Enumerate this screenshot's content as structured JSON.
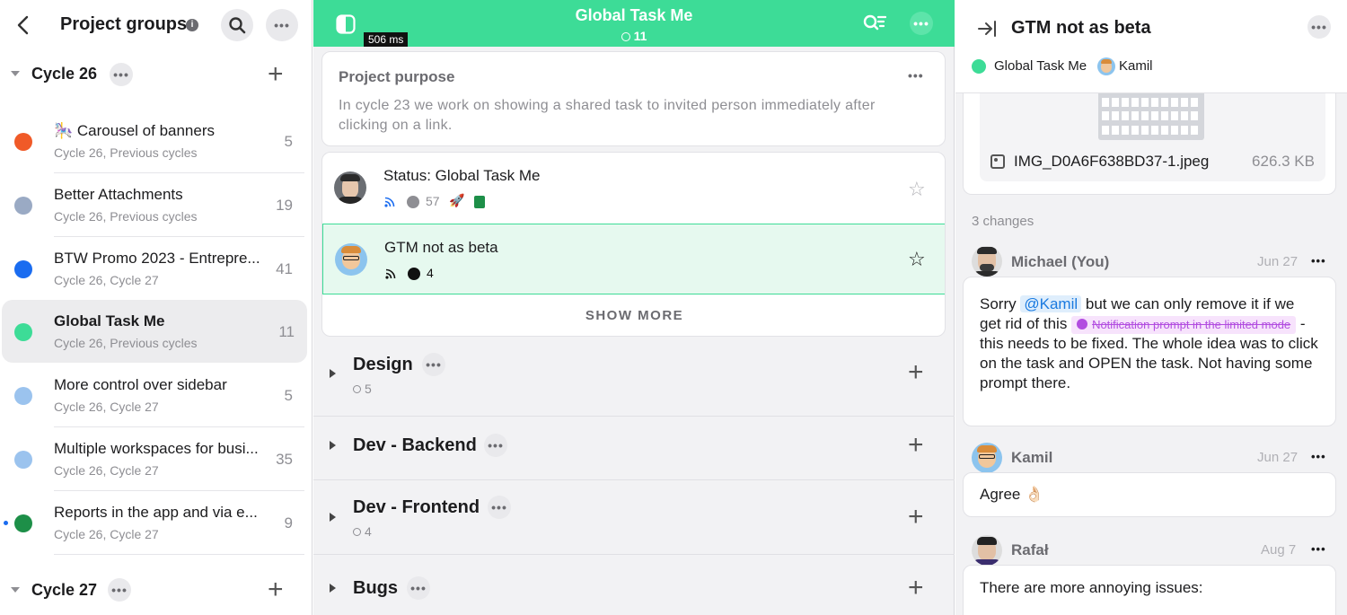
{
  "left": {
    "title": "Project groups",
    "cycles": [
      {
        "label": "Cycle 26"
      },
      {
        "label": "Cycle 27"
      }
    ],
    "items": [
      {
        "emoji": "🎠",
        "title": "Carousel of banners",
        "sub": "Cycle 26, Previous cycles",
        "count": "5",
        "color": "#f05a28"
      },
      {
        "title": "Better Attachments",
        "sub": "Cycle 26, Previous cycles",
        "count": "19",
        "color": "#9aaac4"
      },
      {
        "title": "BTW Promo 2023 - Entrepre...",
        "sub": "Cycle 26, Cycle 27",
        "count": "41",
        "color": "#1a6cf0"
      },
      {
        "title": "Global Task Me",
        "sub": "Cycle 26, Previous cycles",
        "count": "11",
        "color": "#3ddc97"
      },
      {
        "title": "More control over sidebar",
        "sub": "Cycle 26, Cycle 27",
        "count": "5",
        "color": "#9bc3ee"
      },
      {
        "title": "Multiple workspaces for busi...",
        "sub": "Cycle 26, Cycle 27",
        "count": "35",
        "color": "#9bc3ee"
      },
      {
        "title": "Reports in the app and via e...",
        "sub": "Cycle 26, Cycle 27",
        "count": "9",
        "color": "#1d8f48"
      }
    ]
  },
  "middle": {
    "title": "Global Task Me",
    "count": "11",
    "timing": "506 ms",
    "purpose": {
      "heading": "Project purpose",
      "text": "In cycle 23 we work on showing a shared task to invited person immediately after clicking on a link."
    },
    "tasks": [
      {
        "title": "Status: Global Task Me",
        "comments": "57"
      },
      {
        "title": "GTM not as beta",
        "comments": "4"
      }
    ],
    "show_more": "SHOW MORE",
    "groups": [
      {
        "title": "Design",
        "count": "5"
      },
      {
        "title": "Dev - Backend"
      },
      {
        "title": "Dev - Frontend",
        "count": "4"
      },
      {
        "title": "Bugs"
      }
    ]
  },
  "right": {
    "title": "GTM not as beta",
    "project": "Global Task Me",
    "assignee": "Kamil",
    "attachment": {
      "name": "IMG_D0A6F638BD37-1.jpeg",
      "size": "626.3 KB"
    },
    "changes": "3 changes",
    "comments": [
      {
        "author": "Michael (You)",
        "date": "Jun 27",
        "pre": "Sorry",
        "mention": "@Kamil",
        "mid": "but we can only remove it if we get rid of this",
        "task_ref": "Notification prompt in the limited mode",
        "post": "- this needs to be fixed. The whole idea was to click on the task and OPEN the task. Not having some prompt there."
      },
      {
        "author": "Kamil",
        "date": "Jun 27",
        "text": "Agree 👌🏻"
      },
      {
        "author": "Rafał",
        "date": "Aug 7",
        "text": "There are more annoying issues:"
      }
    ]
  },
  "colors": {
    "accent": "#3ddc97",
    "mention": "#1a7ae0",
    "task_ref": "#b24de0"
  }
}
